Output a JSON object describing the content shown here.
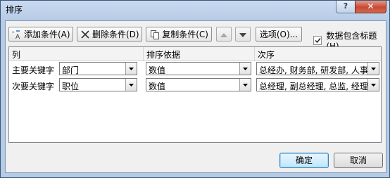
{
  "window": {
    "title": "排序",
    "help_label": "?",
    "close_label": "✕"
  },
  "toolbar": {
    "add_label": "添加条件(A)",
    "delete_label": "删除条件(D)",
    "copy_label": "复制条件(C)",
    "options_label": "选项(O)...",
    "has_headers_label": "数据包含标题(H)",
    "has_headers_checked": true
  },
  "grid": {
    "headers": {
      "column": "列",
      "sort_on": "排序依据",
      "order": "次序"
    },
    "rows": [
      {
        "label": "主要关键字",
        "column": "部门",
        "sort_on": "数值",
        "order": "总经办, 财务部, 研发部, 人事部, 行政部"
      },
      {
        "label": "次要关键字",
        "column": "职位",
        "sort_on": "数值",
        "order": "总经理, 副总经理, 总监, 经理, 职员"
      }
    ]
  },
  "footer": {
    "ok_label": "确定",
    "cancel_label": "取消"
  },
  "colors": {
    "title_bar": "#b6cbe6",
    "close_button": "#c74a34",
    "default_button": "#bee6fd"
  }
}
